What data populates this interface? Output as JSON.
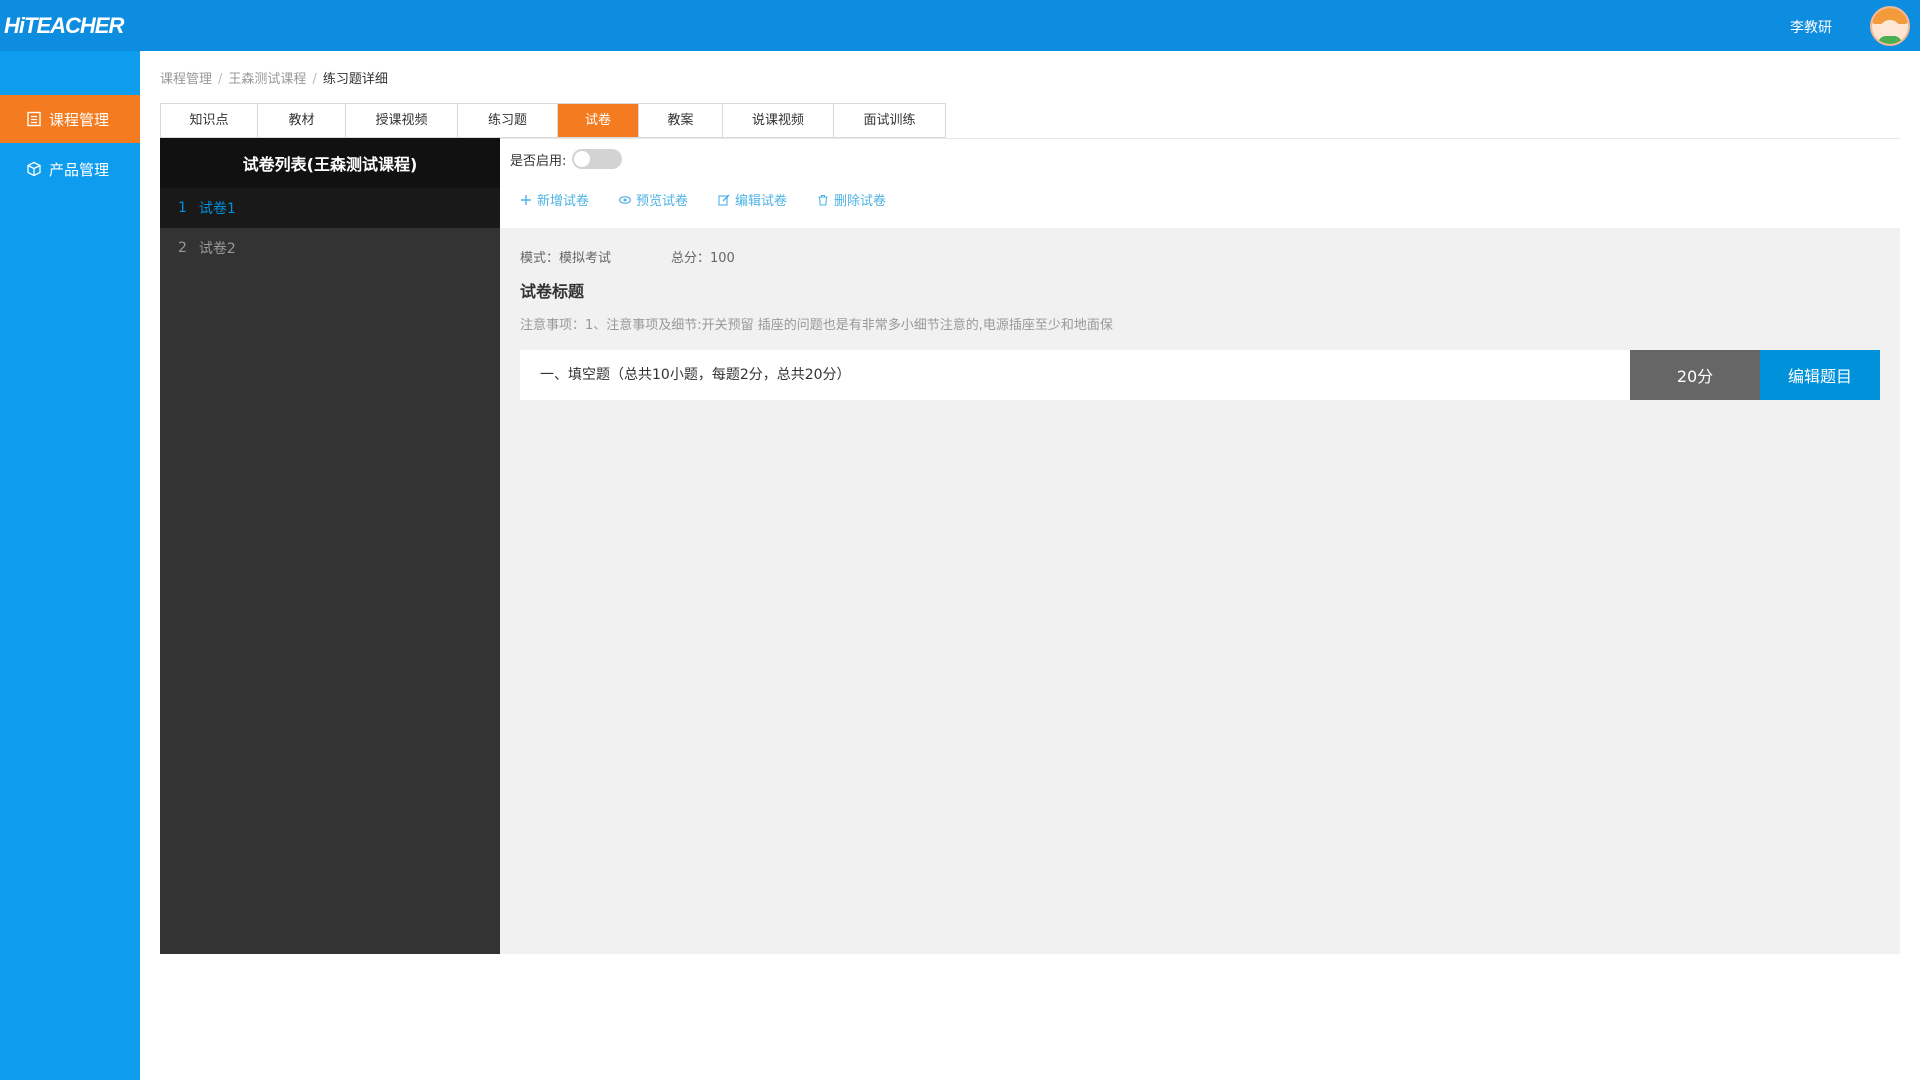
{
  "app": {
    "logo": "HiTEACHER",
    "user_name": "李教研"
  },
  "sidebar": {
    "items": [
      {
        "label": "课程管理",
        "icon": "list-icon",
        "active": true
      },
      {
        "label": "产品管理",
        "icon": "box-icon",
        "active": false
      }
    ]
  },
  "breadcrumb": {
    "items": [
      "课程管理",
      "王森测试课程",
      "练习题详细"
    ],
    "separator": "/"
  },
  "tabs": [
    {
      "label": "知识点"
    },
    {
      "label": "教材"
    },
    {
      "label": "授课视频"
    },
    {
      "label": "练习题"
    },
    {
      "label": "试卷",
      "active": true
    },
    {
      "label": "教案"
    },
    {
      "label": "说课视频"
    },
    {
      "label": "面试训练"
    }
  ],
  "paper_list": {
    "title": "试卷列表(王森测试课程)",
    "items": [
      {
        "index": "1",
        "name": "试卷1",
        "active": true
      },
      {
        "index": "2",
        "name": "试卷2",
        "active": false
      }
    ]
  },
  "toolbar": {
    "enable_label": "是否启用:",
    "enabled": false,
    "actions": [
      {
        "label": "新增试卷",
        "icon": "plus-icon"
      },
      {
        "label": "预览试卷",
        "icon": "eye-icon"
      },
      {
        "label": "编辑试卷",
        "icon": "edit-icon"
      },
      {
        "label": "删除试卷",
        "icon": "trash-icon"
      }
    ]
  },
  "paper": {
    "mode": "模式：模拟考试",
    "total": "总分：100",
    "title": "试卷标题",
    "note": "注意事项：1、注意事项及细节:开关预留 插座的问题也是有非常多小细节注意的,电源插座至少和地面保"
  },
  "section": {
    "label": "一、填空题（总共10小题，每题2分，总共20分）",
    "score": "20分",
    "edit_label": "编辑题目"
  },
  "colors": {
    "brand_blue": "#0d9cee",
    "accent_orange": "#f47b20",
    "link_blue": "#0091db",
    "content_bg": "#f1f1f1"
  }
}
